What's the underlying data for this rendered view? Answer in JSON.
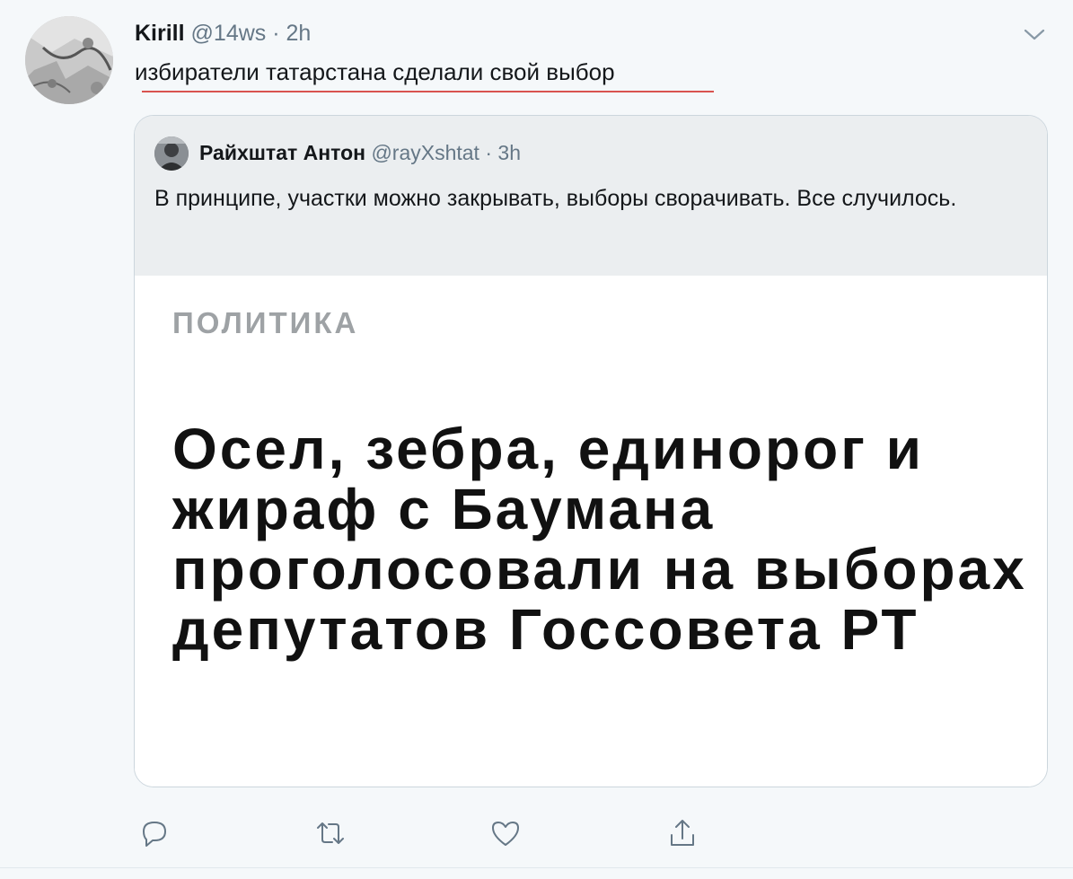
{
  "tweet": {
    "author_name": "Kirill",
    "author_handle": "@14ws",
    "separator": "·",
    "time": "2h",
    "text": "избиратели татарстана сделали свой выбор",
    "avatar_icon": "user-avatar",
    "caret_icon": "chevron-down-icon"
  },
  "quoted": {
    "author_name": "Райхштат Антон",
    "author_handle": "@rayXshtat",
    "separator": "·",
    "time": "3h",
    "text": "В принципе, участки можно закрывать, выборы сворачивать. Все случилось.",
    "image": {
      "rubric": "ПОЛИТИКА",
      "headline": "Осел, зебра, единорог и жираф с Баумана проголосовали на выборах депутатов Госсовета РТ"
    }
  },
  "actions": [
    {
      "name": "reply",
      "icon": "reply-icon"
    },
    {
      "name": "retweet",
      "icon": "retweet-icon"
    },
    {
      "name": "like",
      "icon": "heart-icon"
    },
    {
      "name": "share",
      "icon": "share-icon"
    }
  ],
  "colors": {
    "background": "#f5f8fa",
    "secondary_text": "#657786",
    "quote_header_bg": "#ebeef0",
    "border": "#ccd6dd",
    "icon": "#657786"
  }
}
